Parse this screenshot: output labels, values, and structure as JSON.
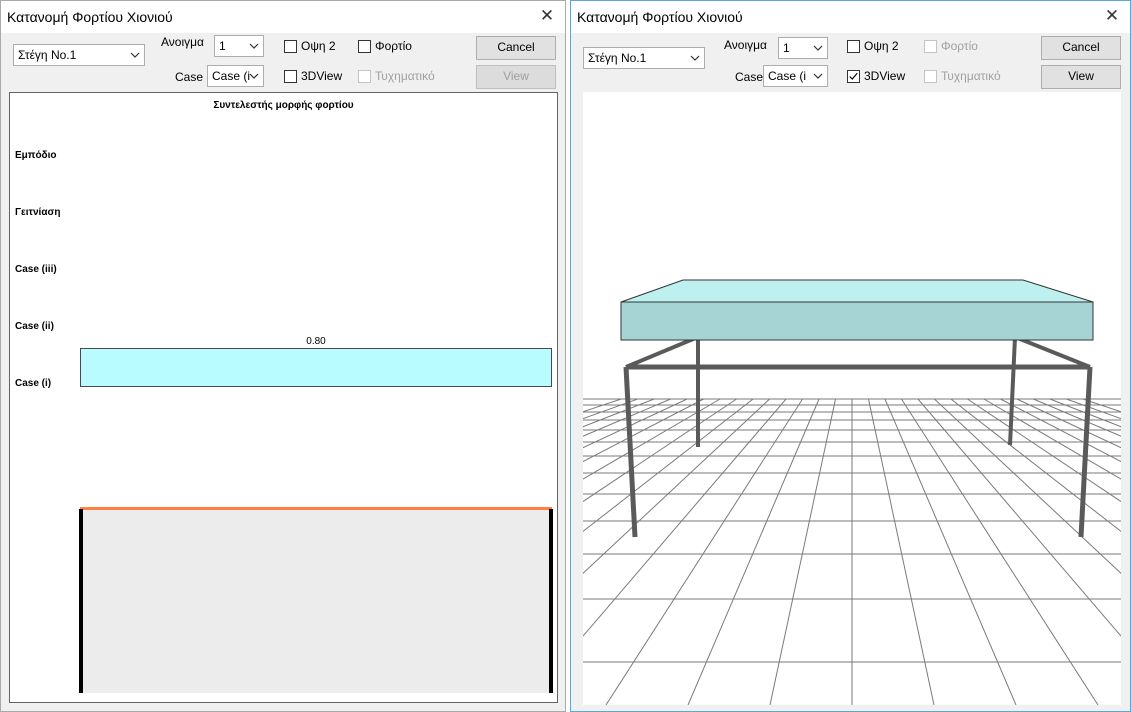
{
  "left_window": {
    "title": "Κατανομή Φορτίου Χιονιού",
    "roof_select": "Στέγη No.1",
    "span_label": "Ανοιγμα",
    "span_value": "1",
    "case_label": "Case",
    "case_value": "Case (i",
    "view2_label": "Οψη 2",
    "view2_checked": false,
    "load_label": "Φορτίο",
    "load_checked": false,
    "view3d_label": "3DView",
    "view3d_checked": false,
    "random_label": "Τυχηματικό",
    "random_checked": false,
    "cancel_label": "Cancel",
    "view_label": "View",
    "diagram": {
      "title": "Συντελεστής μορφής φορτίου",
      "rows": [
        "Εμπόδιο",
        "Γειτνίαση",
        "Case (iii)",
        "Case (ii)",
        "Case (i)"
      ],
      "coefficient_label": "0.80",
      "load_fill": "#b9fcff",
      "roof_line_color": "#ff8040"
    }
  },
  "right_window": {
    "title": "Κατανομή Φορτίου Χιονιού",
    "roof_select": "Στέγη No.1",
    "span_label": "Ανοιγμα",
    "span_value": "1",
    "case_label": "Case",
    "case_value": "Case (i",
    "view2_label": "Οψη 2",
    "view2_checked": false,
    "load_label": "Φορτίο",
    "load_checked": false,
    "view3d_label": "3DView",
    "view3d_checked": true,
    "random_label": "Τυχηματικό",
    "random_checked": false,
    "cancel_label": "Cancel",
    "view_label": "View",
    "scene": {
      "slab_color": "#a6d4d4",
      "slab_top_color": "#bff0f0",
      "frame_color": "#5a5a5a"
    }
  },
  "icons": [
    "close-icon",
    "chevron-down-icon",
    "checkmark-icon"
  ]
}
